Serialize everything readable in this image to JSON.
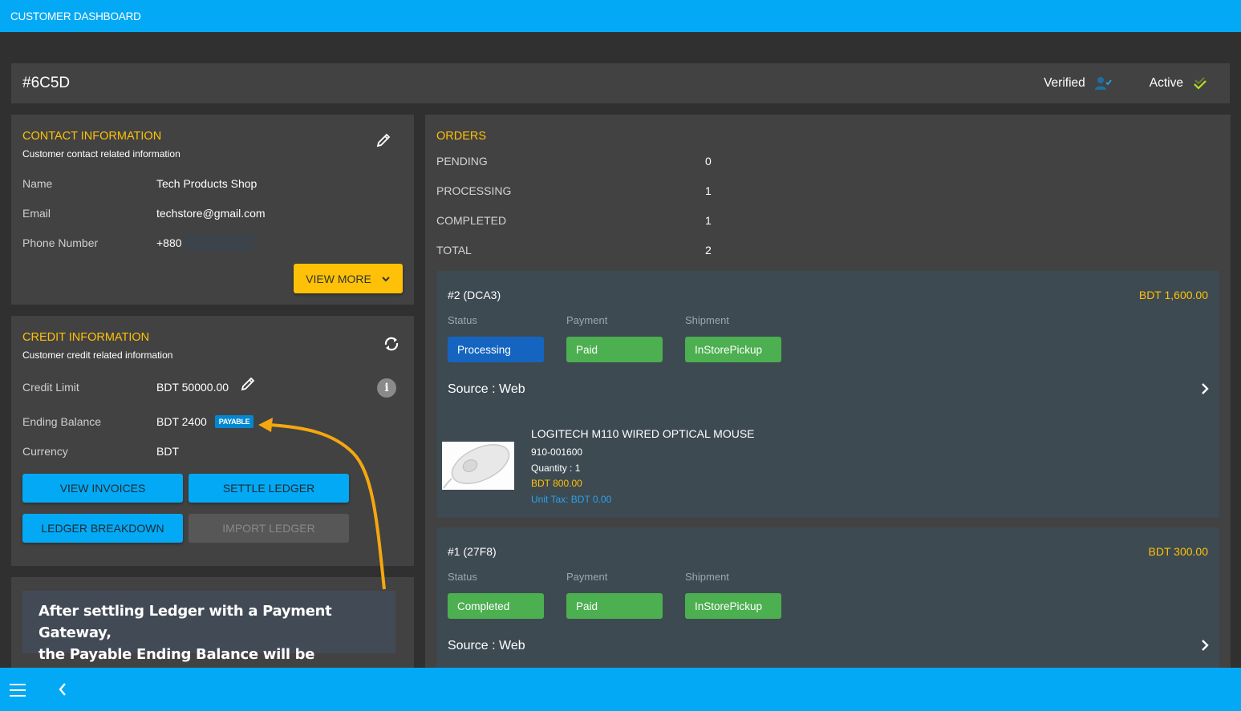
{
  "topbar": {
    "title": "CUSTOMER DASHBOARD"
  },
  "header": {
    "customer_id": "#6C5D",
    "verified_label": "Verified",
    "active_label": "Active"
  },
  "contact": {
    "title": "CONTACT INFORMATION",
    "subtitle": "Customer contact related information",
    "fields": [
      {
        "label": "Name",
        "value": "Tech Products Shop"
      },
      {
        "label": "Email",
        "value": "techstore@gmail.com"
      },
      {
        "label": "Phone Number",
        "value": "+880"
      }
    ],
    "view_more_label": "VIEW MORE"
  },
  "credit": {
    "title": "CREDIT INFORMATION",
    "subtitle": "Customer credit related information",
    "credit_limit_label": "Credit Limit",
    "credit_limit_value": "BDT 50000.00",
    "ending_balance_label": "Ending Balance",
    "ending_balance_value": "BDT 2400",
    "ending_balance_badge": "PAYABLE",
    "currency_label": "Currency",
    "currency_value": "BDT",
    "buttons": {
      "view_invoices": "VIEW INVOICES",
      "settle_ledger": "SETTLE LEDGER",
      "ledger_breakdown": "LEDGER BREAKDOWN",
      "import_ledger": "IMPORT LEDGER"
    }
  },
  "orders": {
    "title": "ORDERS",
    "stats": [
      {
        "label": "PENDING",
        "value": "0"
      },
      {
        "label": "PROCESSING",
        "value": "1"
      },
      {
        "label": "COMPLETED",
        "value": "1"
      },
      {
        "label": "TOTAL",
        "value": "2"
      }
    ],
    "status_label": "Status",
    "payment_label": "Payment",
    "shipment_label": "Shipment",
    "list": [
      {
        "id": "#2 (DCA3)",
        "amount": "BDT 1,600.00",
        "status": "Processing",
        "payment": "Paid",
        "shipment": "InStorePickup",
        "source": "Source : Web",
        "product": {
          "name": "LOGITECH M110 WIRED OPTICAL MOUSE",
          "sku": "910-001600",
          "quantity": "Quantity : 1",
          "price": "BDT 800.00",
          "unit_tax": "Unit Tax: BDT 0.00"
        }
      },
      {
        "id": "#1 (27F8)",
        "amount": "BDT 300.00",
        "status": "Completed",
        "payment": "Paid",
        "shipment": "InStorePickup",
        "source": "Source : Web"
      }
    ]
  },
  "callout": {
    "line1": "After settling Ledger with a Payment Gateway,",
    "line2": "the Payable Ending Balance will be updated"
  },
  "colors": {
    "primary": "#03a9f4",
    "accent": "#ffc107",
    "processing": "#1565c0",
    "success": "#4caf50",
    "payable_badge": "#0288d1"
  }
}
